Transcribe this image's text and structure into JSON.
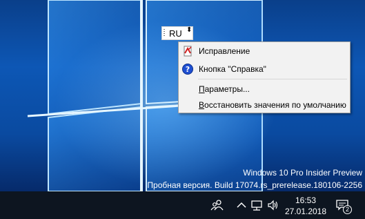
{
  "langbar": {
    "language": "RU"
  },
  "context_menu": {
    "items": [
      {
        "label": "Исправление",
        "icon": "repair-icon"
      },
      {
        "label": "Кнопка \"Справка\"",
        "icon": "help-icon"
      },
      {
        "label": "Параметры...",
        "underline": "П",
        "rest": "араметры..."
      },
      {
        "label": "Восстановить значения по умолчанию",
        "underline": "В",
        "rest": "осстановить значения по умолчанию"
      }
    ]
  },
  "watermark": {
    "line1": "Windows 10 Pro Insider Preview",
    "line2": "Пробная версия. Build 17074.rs_prerelease.180106-2256"
  },
  "taskbar": {
    "time": "16:53",
    "date": "27.01.2018",
    "notification_count": "2",
    "tray_icons": [
      "people-icon",
      "chevron-up-icon",
      "network-icon",
      "volume-icon",
      "action-center-icon"
    ]
  },
  "colors": {
    "desktop_blue": "#0d57b5",
    "taskbar": "#0d1520",
    "menu_bg": "#f2f2f2"
  }
}
